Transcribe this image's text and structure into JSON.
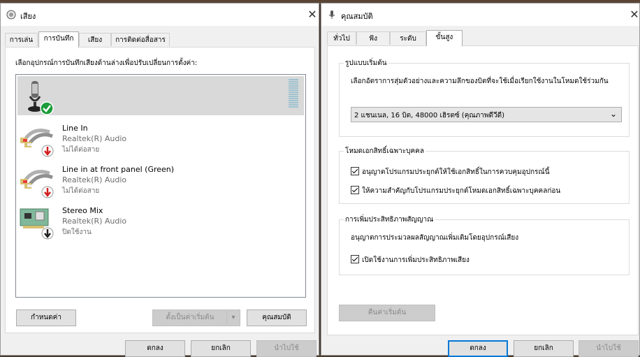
{
  "sound_window": {
    "title": "เสียง",
    "tabs": [
      "การเล่น",
      "การบันทึก",
      "เสียง",
      "การติดต่อสื่อสาร"
    ],
    "active_tab": 1,
    "instruction": "เลือกอุปกรณ์การบันทึกเสียงด้านล่างเพื่อปรับเปลี่ยนการตั้งค่า:",
    "devices": [
      {
        "name": "",
        "driver": "",
        "status": "",
        "icon": "microphone-icon",
        "badge": "default-check-icon",
        "selected": true
      },
      {
        "name": "Line In",
        "driver": "Realtek(R) Audio",
        "status": "ไม่ได้ต่อสาย",
        "icon": "rca-cable-icon",
        "badge": "unplugged-arrow-icon"
      },
      {
        "name": "Line in at front panel (Green)",
        "driver": "Realtek(R) Audio",
        "status": "ไม่ได้ต่อสาย",
        "icon": "rca-cable-icon",
        "badge": "unplugged-arrow-icon"
      },
      {
        "name": "Stereo Mix",
        "driver": "Realtek(R) Audio",
        "status": "ปิดใช้งาน",
        "icon": "sound-card-icon",
        "badge": "disabled-arrow-icon"
      }
    ],
    "configure_btn": "กำหนดค่า",
    "set_default_btn": "ตั้งเป็นค่าเริ่มต้น",
    "properties_btn": "คุณสมบัติ",
    "ok_btn": "ตกลง",
    "cancel_btn": "ยกเลิก",
    "apply_btn": "นำไปใช้"
  },
  "props_window": {
    "title": "คุณสมบัติ",
    "tabs": [
      "ทั่วไป",
      "ฟัง",
      "ระดับ",
      "ขั้นสูง"
    ],
    "active_tab": 3,
    "default_format": {
      "title": "รูปแบบเริ่มต้น",
      "description": "เลือกอัตราการสุ่มตัวอย่างและความลึกของบิตที่จะใช้เมื่อเรียกใช้งานในโหมดใช้ร่วมกัน",
      "selected": "2 แชนเนล, 16 บิต, 48000 เฮิรตซ์ (คุณภาพดีวีดี)"
    },
    "exclusive_mode": {
      "title": "โหมดเอกสิทธิ์เฉพาะบุคคล",
      "options": [
        {
          "label": "อนุญาตโปรแกรมประยุกต์ให้ใช้เอกสิทธิ์ในการควบคุมอุปกรณ์นี้",
          "checked": true
        },
        {
          "label": "ให้ความสำคัญกับโปรแกรมประยุกต์โหมดเอกสิทธิ์เฉพาะบุคคลก่อน",
          "checked": true
        }
      ]
    },
    "enhancements": {
      "title": "การเพิ่มประสิทธิภาพสัญญาณ",
      "description": "อนุญาตการประมวลผลสัญญาณเพิ่มเติมโดยอุปกรณ์เสียง",
      "option": {
        "label": "เปิดใช้งานการเพิ่มประสิทธิภาพเสียง",
        "checked": true
      }
    },
    "restore_defaults_btn": "คืนค่าเริ่มต้น",
    "ok_btn": "ตกลง",
    "cancel_btn": "ยกเลิก",
    "apply_btn": "นำไปใช้"
  },
  "colors": {
    "accent": "#0078d7",
    "selection": "#d9d9d9",
    "disabled_text": "#8a8a8a"
  }
}
